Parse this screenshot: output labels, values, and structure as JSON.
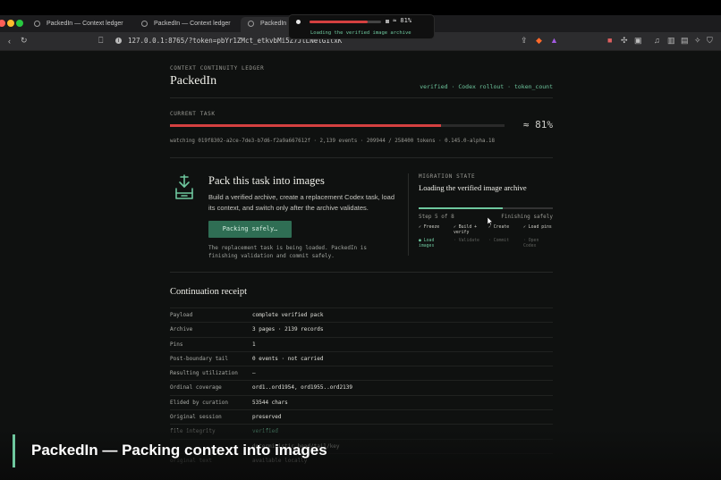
{
  "browser": {
    "tabs": [
      {
        "label": "PackedIn — Context ledger"
      },
      {
        "label": "PackedIn — Context ledger"
      },
      {
        "label": "PackedIn — Co"
      }
    ],
    "url": "127.0.0.1:8765/?token=pbYr1ZMct_etkvbMi5Z7JlLNelG1txK",
    "icons": [
      "back-icon",
      "reload-icon",
      "bookmark-icon",
      "info-icon",
      "share-icon",
      "brave-shield-icon",
      "brave-rewards-icon",
      "extension-icon",
      "music-icon",
      "sidebar-icon",
      "wallet-icon",
      "ai-icon",
      "vpn-icon",
      "menu-icon"
    ]
  },
  "overlay": {
    "progress": 0.81,
    "percent_label": "≈ 81%",
    "message": "Loading the verified image archive"
  },
  "header": {
    "eyebrow": "CONTEXT CONTINUITY LEDGER",
    "title": "PackedIn",
    "links": [
      "verified",
      "Codex rollout",
      "token_count"
    ],
    "link_sep": " · "
  },
  "current_task": {
    "label": "CURRENT TASK",
    "progress": 0.81,
    "percent_label": "≈ 81%",
    "meta": "watching 019f8302-a2ce-7de3-b7d6-f2a9a667612f · 2,139 events · 209944 / 258400 tokens · 0.145.0-alpha.18"
  },
  "pack": {
    "icon": "archive-download-icon",
    "title": "Pack this task into images",
    "description": "Build a verified archive, create a replacement Codex task, load its context, and switch only after the archive validates.",
    "button": "Packing safely…",
    "note": "The replacement task is being loaded. PackedIn is finishing validation and commit safely."
  },
  "migration": {
    "label": "MIGRATION STATE",
    "state": "Loading the verified image archive",
    "progress": 0.625,
    "step": "Step 5 of 8",
    "step_status": "Finishing safely",
    "stages": [
      {
        "label": "✓ Freeze",
        "status": "done"
      },
      {
        "label": "✓ Build + verify",
        "status": "done"
      },
      {
        "label": "✓ Create",
        "status": "done"
      },
      {
        "label": "✓ Load pins",
        "status": "done"
      },
      {
        "label": "● Load images",
        "status": "current"
      },
      {
        "label": "· Validate",
        "status": "pending"
      },
      {
        "label": "· Commit",
        "status": "pending"
      },
      {
        "label": "· Open Codex",
        "status": "pending"
      }
    ]
  },
  "receipt": {
    "title": "Continuation receipt",
    "rows": [
      {
        "key": "Payload",
        "value": "complete verified pack"
      },
      {
        "key": "Archive",
        "value": "3 pages · 2139 records"
      },
      {
        "key": "Pins",
        "value": "1"
      },
      {
        "key": "Post-boundary tail",
        "value": "0 events · not carried"
      },
      {
        "key": "Resulting utilization",
        "value": "—"
      },
      {
        "key": "Ordinal coverage",
        "value": "ord1..ord1954, ord1955..ord2139"
      },
      {
        "key": "Elided by curation",
        "value": "53544 chars"
      },
      {
        "key": "Original session",
        "value": "preserved"
      },
      {
        "key": "file integrity",
        "value": "verified",
        "good": true
      },
      {
        "key": "",
        "value": "deterministic head/tail/key"
      },
      {
        "key": "original text",
        "value": "available locally"
      }
    ]
  },
  "caption": {
    "text": "PackedIn — Packing context into images"
  },
  "colors": {
    "accent": "#6ec79e",
    "progress": "#d44040",
    "button": "#2f6e54",
    "background": "#0f1110"
  }
}
